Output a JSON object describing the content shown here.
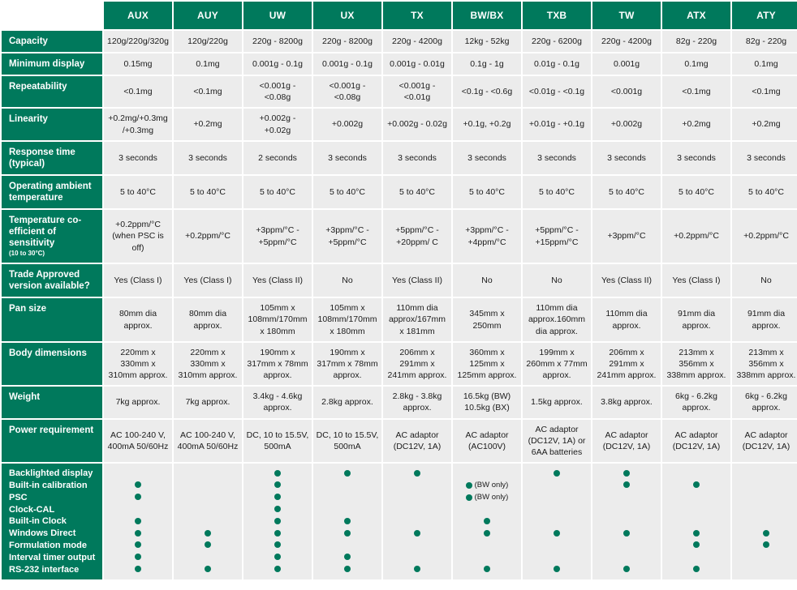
{
  "colors": {
    "brand_green": "#00795C",
    "cell_grey": "#ECECEC",
    "page_background": "#FFFFFF",
    "header_text": "#FFFFFF",
    "cell_text": "#1B1B1B"
  },
  "table": {
    "corner_label": "",
    "models": [
      "AUX",
      "AUY",
      "UW",
      "UX",
      "TX",
      "BW/BX",
      "TXB",
      "TW",
      "ATX",
      "ATY"
    ],
    "rows": [
      {
        "label": "Capacity",
        "sub": "",
        "values": [
          "120g/220g/320g",
          "120g/220g",
          "220g - 8200g",
          "220g - 8200g",
          "220g - 4200g",
          "12kg - 52kg",
          "220g - 6200g",
          "220g - 4200g",
          "82g - 220g",
          "82g - 220g"
        ]
      },
      {
        "label": "Minimum display",
        "sub": "",
        "values": [
          "0.15mg",
          "0.1mg",
          "0.001g - 0.1g",
          "0.001g - 0.1g",
          "0.001g - 0.01g",
          "0.1g - 1g",
          "0.01g - 0.1g",
          "0.001g",
          "0.1mg",
          "0.1mg"
        ]
      },
      {
        "label": "Repeatability",
        "sub": "",
        "values": [
          "<0.1mg",
          "<0.1mg",
          "<0.001g - <0.08g",
          "<0.001g - <0.08g",
          "<0.001g - <0.01g",
          "<0.1g - <0.6g",
          "<0.01g - <0.1g",
          "<0.001g",
          "<0.1mg",
          "<0.1mg"
        ]
      },
      {
        "label": "Linearity",
        "sub": "",
        "values": [
          "+0.2mg/+0.3mg /+0.3mg",
          "+0.2mg",
          "+0.002g - +0.02g",
          "+0.002g",
          "+0.002g - 0.02g",
          "+0.1g, +0.2g",
          "+0.01g - +0.1g",
          "+0.002g",
          "+0.2mg",
          "+0.2mg"
        ]
      },
      {
        "label": "Response time (typical)",
        "sub": "",
        "values": [
          "3 seconds",
          "3 seconds",
          "2 seconds",
          "3 seconds",
          "3 seconds",
          "3 seconds",
          "3 seconds",
          "3 seconds",
          "3 seconds",
          "3 seconds"
        ]
      },
      {
        "label": "Operating ambient temperature",
        "sub": "",
        "values": [
          "5 to 40°C",
          "5 to 40°C",
          "5 to 40°C",
          "5 to 40°C",
          "5 to 40°C",
          "5 to 40°C",
          "5 to 40°C",
          "5 to 40°C",
          "5 to 40°C",
          "5 to 40°C"
        ]
      },
      {
        "label": "Temperature co-efficient of sensitivity",
        "sub": "(10 to 30°C)",
        "values": [
          "+0.2ppm/°C (when PSC is off)",
          "+0.2ppm/°C",
          "+3ppm/°C - +5ppm/°C",
          "+3ppm/°C - +5ppm/°C",
          "+5ppm/°C - +20ppm/ C",
          "+3ppm/°C - +4ppm/°C",
          "+5ppm/°C - +15ppm/°C",
          "+3ppm/°C",
          "+0.2ppm/°C",
          "+0.2ppm/°C"
        ]
      },
      {
        "label": "Trade Approved version available?",
        "sub": "",
        "values": [
          "Yes (Class I)",
          "Yes (Class I)",
          "Yes (Class II)",
          "No",
          "Yes (Class II)",
          "No",
          "No",
          "Yes (Class II)",
          "Yes (Class I)",
          "No"
        ]
      },
      {
        "label": "Pan size",
        "sub": "",
        "values": [
          "80mm dia approx.",
          "80mm dia approx.",
          "105mm x 108mm/170mm x 180mm",
          "105mm x 108mm/170mm x 180mm",
          "110mm dia approx/167mm x 181mm",
          "345mm x 250mm",
          "110mm dia approx.160mm dia approx.",
          "110mm dia approx.",
          "91mm dia approx.",
          "91mm dia approx."
        ]
      },
      {
        "label": "Body dimensions",
        "sub": "",
        "values": [
          "220mm x 330mm x 310mm approx.",
          "220mm x 330mm x 310mm approx.",
          "190mm x 317mm x 78mm approx.",
          "190mm x 317mm x 78mm approx.",
          "206mm x 291mm x 241mm approx.",
          "360mm x 125mm x 125mm approx.",
          "199mm x 260mm x 77mm approx.",
          "206mm x 291mm x 241mm approx.",
          "213mm x 356mm x 338mm approx.",
          "213mm x 356mm x 338mm approx."
        ]
      },
      {
        "label": "Weight",
        "sub": "",
        "values": [
          "7kg approx.",
          "7kg approx.",
          "3.4kg - 4.6kg approx.",
          "2.8kg approx.",
          "2.8kg - 3.8kg approx.",
          "16.5kg (BW) 10.5kg (BX)",
          "1.5kg approx.",
          "3.8kg approx.",
          "6kg - 6.2kg approx.",
          "6kg - 6.2kg approx."
        ]
      },
      {
        "label": "Power requirement",
        "sub": "",
        "values": [
          "AC 100-240 V, 400mA 50/60Hz",
          "AC 100-240 V, 400mA 50/60Hz",
          "DC, 10 to 15.5V, 500mA",
          "DC, 10 to 15.5V, 500mA",
          "AC adaptor (DC12V, 1A)",
          "AC adaptor (AC100V)",
          "AC adaptor (DC12V, 1A) or 6AA batteries",
          "AC adaptor (DC12V, 1A)",
          "AC adaptor (DC12V, 1A)",
          "AC adaptor (DC12V, 1A)"
        ]
      }
    ],
    "features": {
      "labels": [
        "Backlighted display",
        "Built-in calibration",
        "PSC",
        "Clock-CAL",
        "Built-in Clock",
        "Windows Direct",
        "Formulation mode",
        "Interval timer output",
        "RS-232 interface"
      ],
      "matrix": [
        {
          "model": "AUX",
          "marks": [
            "",
            "dot",
            "dot",
            "",
            "dot",
            "dot",
            "dot",
            "dot",
            "dot"
          ]
        },
        {
          "model": "AUY",
          "marks": [
            "",
            "",
            "",
            "",
            "",
            "dot",
            "dot",
            "",
            "dot"
          ]
        },
        {
          "model": "UW",
          "marks": [
            "dot",
            "dot",
            "dot",
            "dot",
            "dot",
            "dot",
            "dot",
            "dot",
            "dot"
          ]
        },
        {
          "model": "UX",
          "marks": [
            "dot",
            "",
            "",
            "",
            "dot",
            "dot",
            "",
            "dot",
            "dot"
          ]
        },
        {
          "model": "TX",
          "marks": [
            "dot",
            "",
            "",
            "",
            "",
            "dot",
            "",
            "",
            "dot"
          ]
        },
        {
          "model": "BW/BX",
          "marks": [
            "",
            "dot",
            "dot",
            "",
            "dot",
            "dot",
            "",
            "",
            "dot"
          ]
        },
        {
          "model": "TXB",
          "marks": [
            "dot",
            "",
            "",
            "",
            "",
            "dot",
            "",
            "",
            "dot"
          ]
        },
        {
          "model": "TW",
          "marks": [
            "dot",
            "dot",
            "",
            "",
            "",
            "dot",
            "",
            "",
            "dot"
          ]
        },
        {
          "model": "ATX",
          "marks": [
            "",
            "dot",
            "",
            "",
            "",
            "dot",
            "dot",
            "",
            "dot"
          ]
        },
        {
          "model": "ATY",
          "marks": [
            "",
            "",
            "",
            "",
            "",
            "dot",
            "dot",
            "",
            ""
          ]
        }
      ],
      "notes": [
        {
          "model": "BW/BX",
          "row": 1,
          "text": "(BW only)"
        },
        {
          "model": "BW/BX",
          "row": 2,
          "text": "(BW only)"
        }
      ]
    }
  }
}
